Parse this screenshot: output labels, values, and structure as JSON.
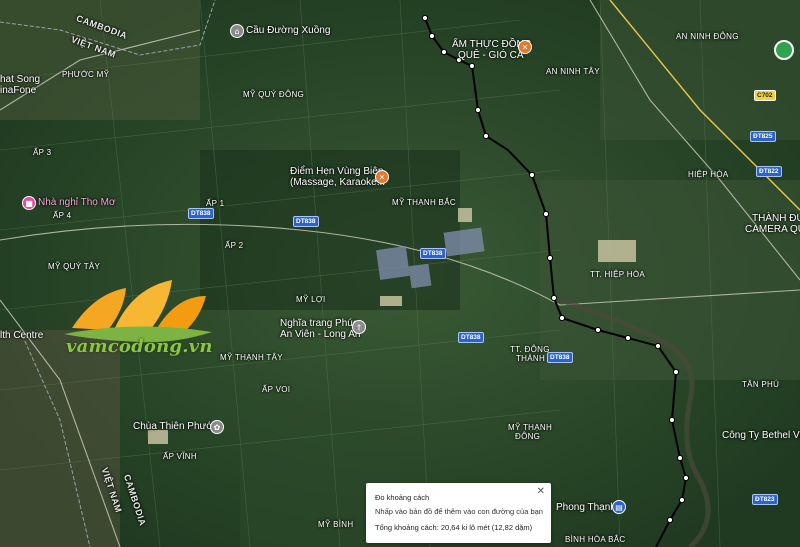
{
  "map": {
    "countries": [
      "CAMBODIA",
      "VIỆT NAM",
      "VIỆT NAM",
      "CAMBODIA"
    ],
    "places": {
      "cau_duong_xuong": "Cầu Đường Xuồng",
      "am_thuc_line1": "ẨM THỰC ĐỒNG",
      "am_thuc_line2": "QUÊ - GIÓ CÁ",
      "an_ninh_tay": "AN NINH TÂY",
      "an_ninh_dong": "AN NINH ĐÔNG",
      "phuoc_my": "PHƯỚC MỸ",
      "my_quy_dong": "MỸ QUÝ ĐÔNG",
      "hat_song": "hat Song",
      "vinafone": "inaFone",
      "ap_3": "ẤP 3",
      "nha_nghi": "Nhà nghỉ Thọ Mơ",
      "ap_4": "ẤP 4",
      "diem_hen_line1": "Điểm Hẹn Vùng Biên",
      "diem_hen_line2": "(Massage, Karaoke...",
      "my_thanh_bac": "MỸ THẠNH BẮC",
      "ap_1": "ẤP 1",
      "ap_2": "ẤP 2",
      "my_quy_tay": "MỸ QUÝ TÂY",
      "my_loi": "MỸ LỢI",
      "nghia_trang_line1": "Nghĩa trang Phúc",
      "nghia_trang_line2": "An Viên - Long An",
      "health_centre": "lth Centre",
      "my_thanh_tay": "MỸ THẠNH TÂY",
      "ap_voi": "ẤP VOI",
      "chua_thien_phuoc": "Chùa Thiên Phước",
      "ap_vinh": "ẤP VĨNH",
      "tt_dong_line1": "TT. ĐÔNG",
      "tt_dong_line2": "THÀNH",
      "my_thanh_line1": "MỸ THẠNH",
      "my_thanh_line2": "ĐÔNG",
      "my_binh": "MỸ BÌNH",
      "phong_thanh": "Phong Thạnh",
      "binh_hoa_bac": "BÌNH HÒA BẮC",
      "hiep_hoa": "HIỆP HÒA",
      "tt_hiep_hoa": "TT. HIỆP HÒA",
      "thanh_duc": "THÀNH ĐỨ",
      "camera_qua": "CAMERA QUA",
      "tan_phu": "TÂN PHÚ",
      "bethel": "Công Ty Bethel Vina"
    },
    "roads": {
      "dt838_a": "DT838",
      "dt838_b": "DT838",
      "dt838_c": "DT838",
      "dt838_d": "DT838",
      "dt838_e": "DT838",
      "dt838_f": "ĐT838",
      "dt825": "ĐT825",
      "dt822": "ĐT822",
      "dt823": "ĐT823",
      "c702": "C702"
    }
  },
  "watermark": {
    "text": "vamcodong.vn"
  },
  "distance_popup": {
    "title": "Đo khoảng cách",
    "subtitle": "Nhấp vào bản đồ để thêm vào con đường của bạn",
    "total": "Tổng khoảng cách: 20,64 ki lô mét (12,82 dặm)",
    "close_icon": "✕"
  },
  "icons": {
    "restaurant": "restaurant-icon",
    "bridge": "landmark-icon",
    "hotel": "hotel-icon",
    "cemetery": "cemetery-icon",
    "temple": "temple-icon",
    "shopping": "shopping-icon"
  },
  "colors": {
    "measure_line": "#000000",
    "road_shield": "#2b63c9",
    "poi_orange": "#e8772e",
    "poi_pink": "#e64aa6",
    "poi_grey": "#8a8a8a"
  }
}
